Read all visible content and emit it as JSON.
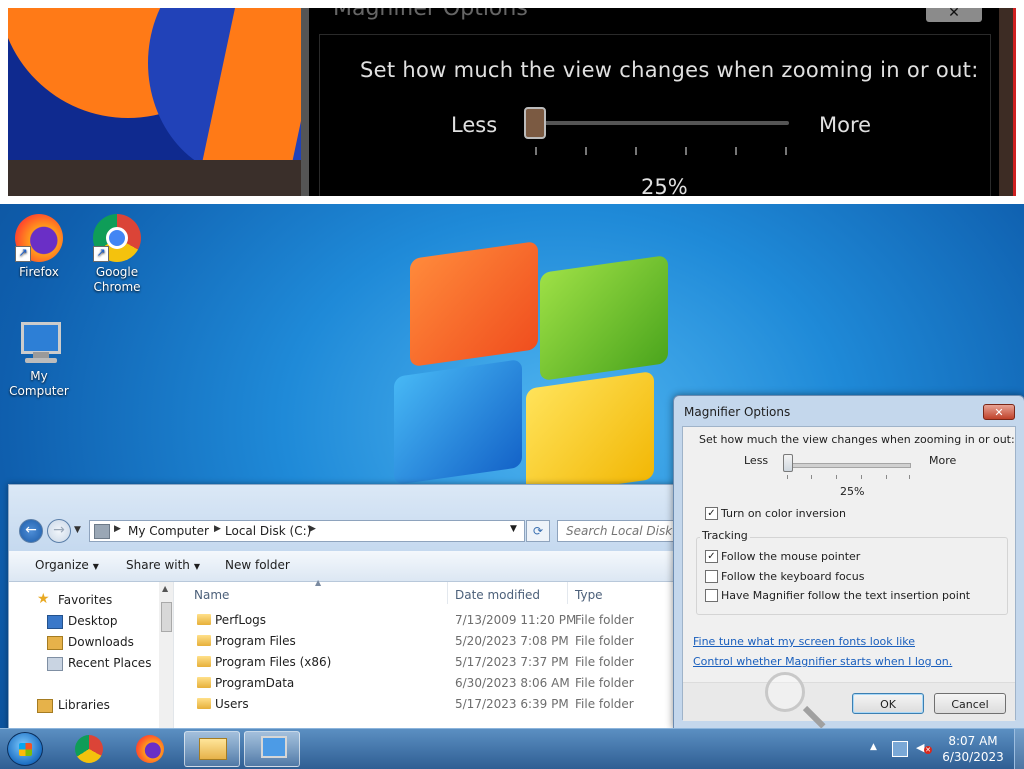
{
  "magnifier_view": {
    "dialog_title": "Magnifier Options",
    "close_label": "✕",
    "instruction": "Set how much the view changes when zooming in or out:",
    "less_label": "Less",
    "more_label": "More",
    "value": "25%"
  },
  "desktop": {
    "icons": [
      {
        "label": "Firefox",
        "icon": "firefox-icon"
      },
      {
        "label": "Google Chrome",
        "icon": "chrome-icon"
      },
      {
        "label": "My Computer",
        "icon": "computer-icon"
      }
    ]
  },
  "explorer": {
    "address": {
      "crumbs": [
        "My Computer",
        "Local Disk (C:)"
      ]
    },
    "search_placeholder": "Search Local Disk (C:)",
    "toolbar": {
      "organize": "Organize",
      "share_with": "Share with",
      "new_folder": "New folder"
    },
    "nav": {
      "favorites": "Favorites",
      "desktop": "Desktop",
      "downloads": "Downloads",
      "recent_places": "Recent Places",
      "libraries": "Libraries"
    },
    "columns": {
      "name": "Name",
      "date_modified": "Date modified",
      "type": "Type"
    },
    "rows": [
      {
        "name": "PerfLogs",
        "date": "7/13/2009 11:20 PM",
        "type": "File folder"
      },
      {
        "name": "Program Files",
        "date": "5/20/2023 7:08 PM",
        "type": "File folder"
      },
      {
        "name": "Program Files (x86)",
        "date": "5/17/2023 7:37 PM",
        "type": "File folder"
      },
      {
        "name": "ProgramData",
        "date": "6/30/2023 8:06 AM",
        "type": "File folder"
      },
      {
        "name": "Users",
        "date": "5/17/2023 6:39 PM",
        "type": "File folder"
      }
    ]
  },
  "magnifier_options": {
    "title": "Magnifier Options",
    "close_label": "✕",
    "instruction": "Set how much the view changes when zooming in or out:",
    "less_label": "Less",
    "more_label": "More",
    "zoom_increment": "25%",
    "zoom_slider_fraction": 0,
    "color_inversion": {
      "label": "Turn on color inversion",
      "checked": true
    },
    "tracking_label": "Tracking",
    "tracking": [
      {
        "label": "Follow the mouse pointer",
        "checked": true
      },
      {
        "label": "Follow the keyboard focus",
        "checked": false
      },
      {
        "label": "Have Magnifier follow the text insertion point",
        "checked": false
      }
    ],
    "links": {
      "fonts": "Fine tune what my screen fonts look like",
      "startup": "Control whether Magnifier starts when I log on."
    },
    "ok_label": "OK",
    "cancel_label": "Cancel"
  },
  "taskbar": {
    "clock_time": "8:07 AM",
    "clock_date": "6/30/2023",
    "pinned": [
      "chrome-icon",
      "firefox-icon",
      "explorer-icon",
      "magnifier-icon"
    ]
  },
  "colors": {
    "accent": "#1a5fbd",
    "taskbar": "#2f5e93",
    "close_red": "#c0412a"
  }
}
